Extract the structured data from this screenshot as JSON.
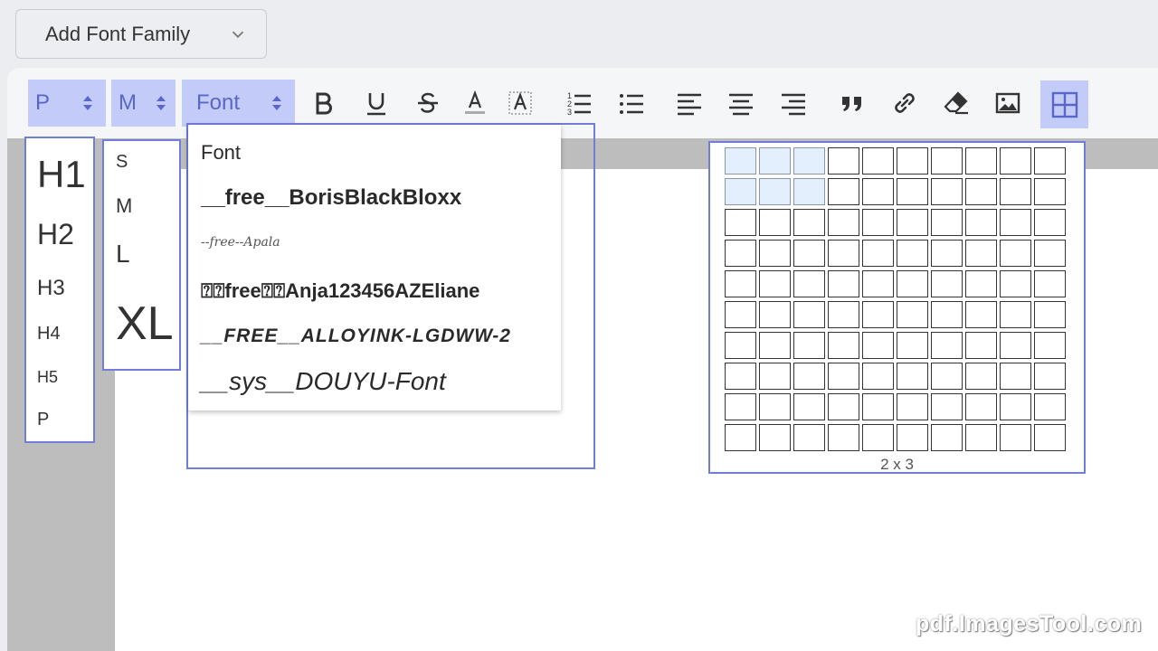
{
  "add_font": {
    "label": "Add Font Family",
    "icon": "chevron-down-icon"
  },
  "toolbar": {
    "heading_select": "P",
    "size_select": "M",
    "font_select": "Font",
    "accent_color": "#c3cbf8",
    "tools": [
      "bold-icon",
      "underline-icon",
      "strikethrough-icon",
      "font-color-icon",
      "highlight-icon",
      "ordered-list-icon",
      "bullet-list-icon",
      "align-left-icon",
      "align-center-icon",
      "align-right-icon",
      "quote-icon",
      "link-icon",
      "eraser-icon",
      "image-icon",
      "table-icon"
    ]
  },
  "heading_menu": {
    "items": [
      "H1",
      "H2",
      "H3",
      "H4",
      "H5",
      "P"
    ]
  },
  "size_menu": {
    "items": [
      "S",
      "M",
      "L",
      "XL"
    ]
  },
  "font_menu": {
    "items": [
      "Font",
      "__free__BorisBlackBloxx",
      "--free--Apala",
      "⍰⍰free⍰⍰Anja123456AZEliane",
      "__FREE__ALLOYINK-LGDWW-2",
      "__sys__DOUYU-Font"
    ]
  },
  "table_picker": {
    "rows": 10,
    "cols": 10,
    "selected_rows": 2,
    "selected_cols": 3,
    "label": "2 x 3"
  },
  "watermark": "pdf.ImagesTool.com"
}
